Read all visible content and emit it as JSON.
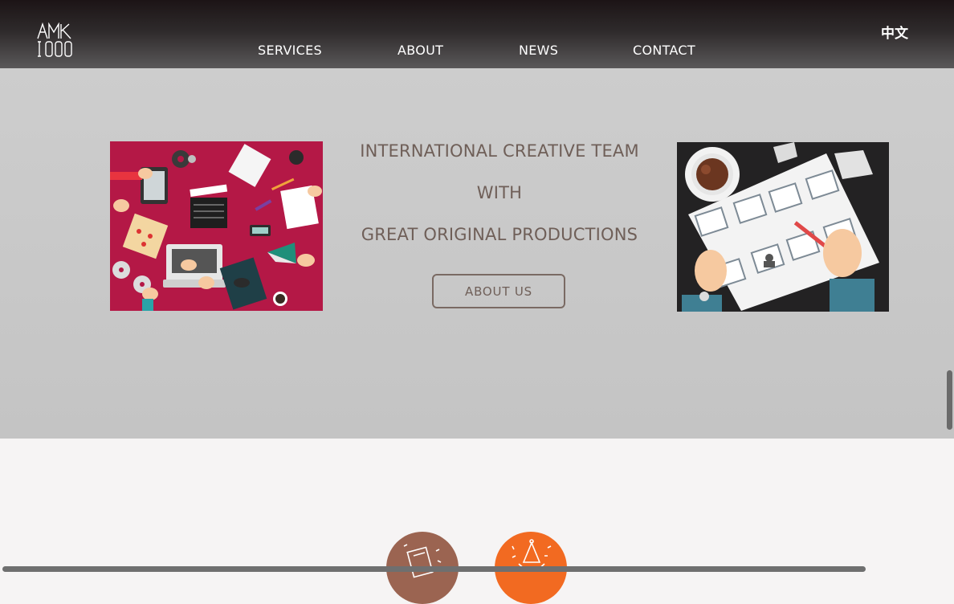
{
  "header": {
    "logo_name": "AMK logo",
    "nav": [
      {
        "label": "SERVICES"
      },
      {
        "label": "ABOUT"
      },
      {
        "label": "NEWS"
      },
      {
        "label": "CONTACT"
      }
    ],
    "language_label": "中文"
  },
  "hero": {
    "tagline_lines": [
      "INTERNATIONAL CREATIVE TEAM",
      "WITH",
      "GREAT ORIGINAL PRODUCTIONS"
    ],
    "about_button_label": "ABOUT US",
    "left_illustration": "creative-desk-illustration",
    "right_illustration": "storyboard-illustration"
  },
  "features": {
    "icons": [
      "notebook-icon",
      "party-icon"
    ]
  },
  "colors": {
    "header_dark": "#1c1416",
    "hero_bg": "#cbcbcb",
    "text_brown": "#6f5f58",
    "crimson": "#b41846",
    "circle_brown": "#9b6451",
    "circle_orange": "#f26a21"
  }
}
